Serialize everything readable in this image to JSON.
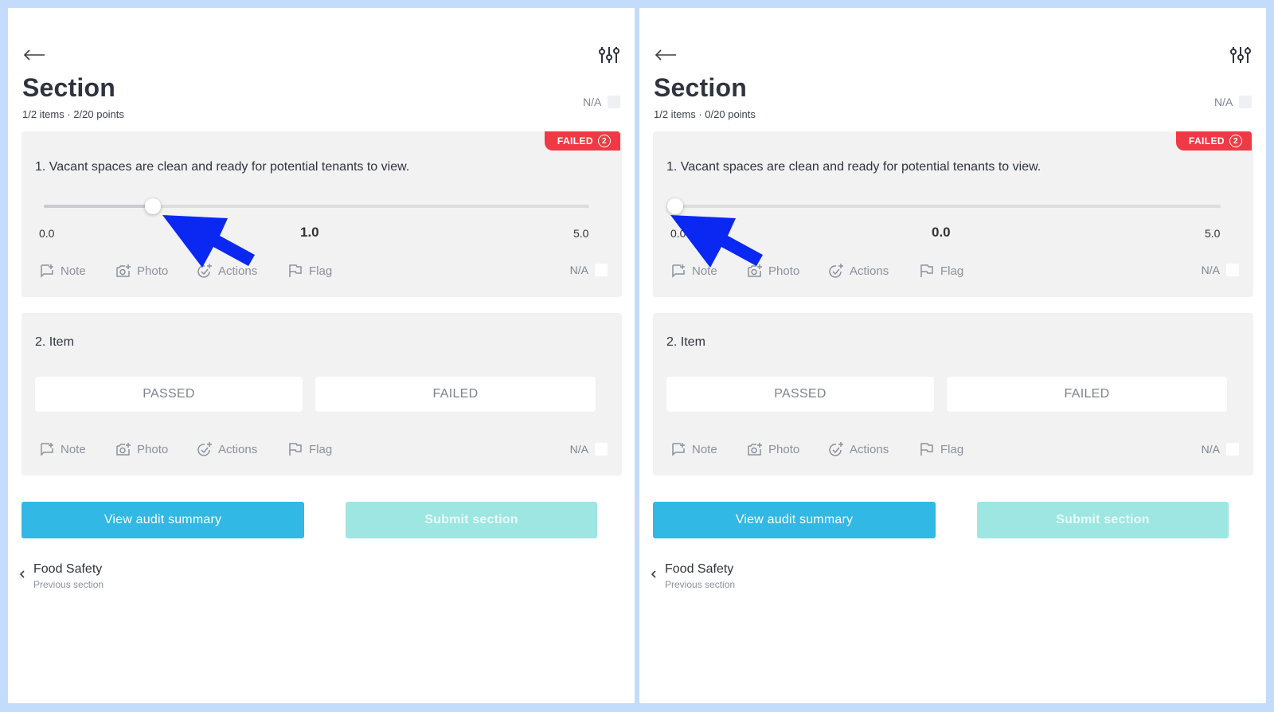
{
  "colors": {
    "accent_blue": "#31b8e5",
    "submit_disabled": "#9de6e1",
    "failed_red": "#ef3a45",
    "annotation_arrow": "#0a28f2",
    "frame_bg": "#c3dcfb"
  },
  "icons": [
    "back-arrow-icon",
    "filter-sliders-icon",
    "note-icon",
    "photo-icon",
    "actions-icon",
    "flag-icon",
    "chevron-left-icon",
    "annotation-arrow"
  ],
  "panels": [
    {
      "header": {
        "title": "Section",
        "subtitle": "1/2 items · 2/20 points",
        "na_label": "N/A"
      },
      "item1": {
        "question": "1. Vacant spaces are clean and ready for potential tenants to view.",
        "badge_label": "FAILED",
        "badge_count": "2",
        "slider": {
          "min": 0.0,
          "max": 5.0,
          "value": 1.0,
          "min_label": "0.0",
          "max_label": "5.0",
          "value_label": "1.0"
        },
        "actions": {
          "note": "Note",
          "photo": "Photo",
          "actions": "Actions",
          "flag": "Flag",
          "na": "N/A"
        }
      },
      "item2": {
        "title": "2. Item",
        "passed": "PASSED",
        "failed": "FAILED",
        "actions": {
          "note": "Note",
          "photo": "Photo",
          "actions": "Actions",
          "flag": "Flag",
          "na": "N/A"
        }
      },
      "buttons": {
        "summary": "View audit summary",
        "submit": "Submit section"
      },
      "previous": {
        "title": "Food Safety",
        "subtitle": "Previous section"
      }
    },
    {
      "header": {
        "title": "Section",
        "subtitle": "1/2 items · 0/20 points",
        "na_label": "N/A"
      },
      "item1": {
        "question": "1. Vacant spaces are clean and ready for potential tenants to view.",
        "badge_label": "FAILED",
        "badge_count": "2",
        "slider": {
          "min": 0.0,
          "max": 5.0,
          "value": 0.0,
          "min_label": "0.0",
          "max_label": "5.0",
          "value_label": "0.0"
        },
        "actions": {
          "note": "Note",
          "photo": "Photo",
          "actions": "Actions",
          "flag": "Flag",
          "na": "N/A"
        }
      },
      "item2": {
        "title": "2. Item",
        "passed": "PASSED",
        "failed": "FAILED",
        "actions": {
          "note": "Note",
          "photo": "Photo",
          "actions": "Actions",
          "flag": "Flag",
          "na": "N/A"
        }
      },
      "buttons": {
        "summary": "View audit summary",
        "submit": "Submit section"
      },
      "previous": {
        "title": "Food Safety",
        "subtitle": "Previous section"
      }
    }
  ]
}
